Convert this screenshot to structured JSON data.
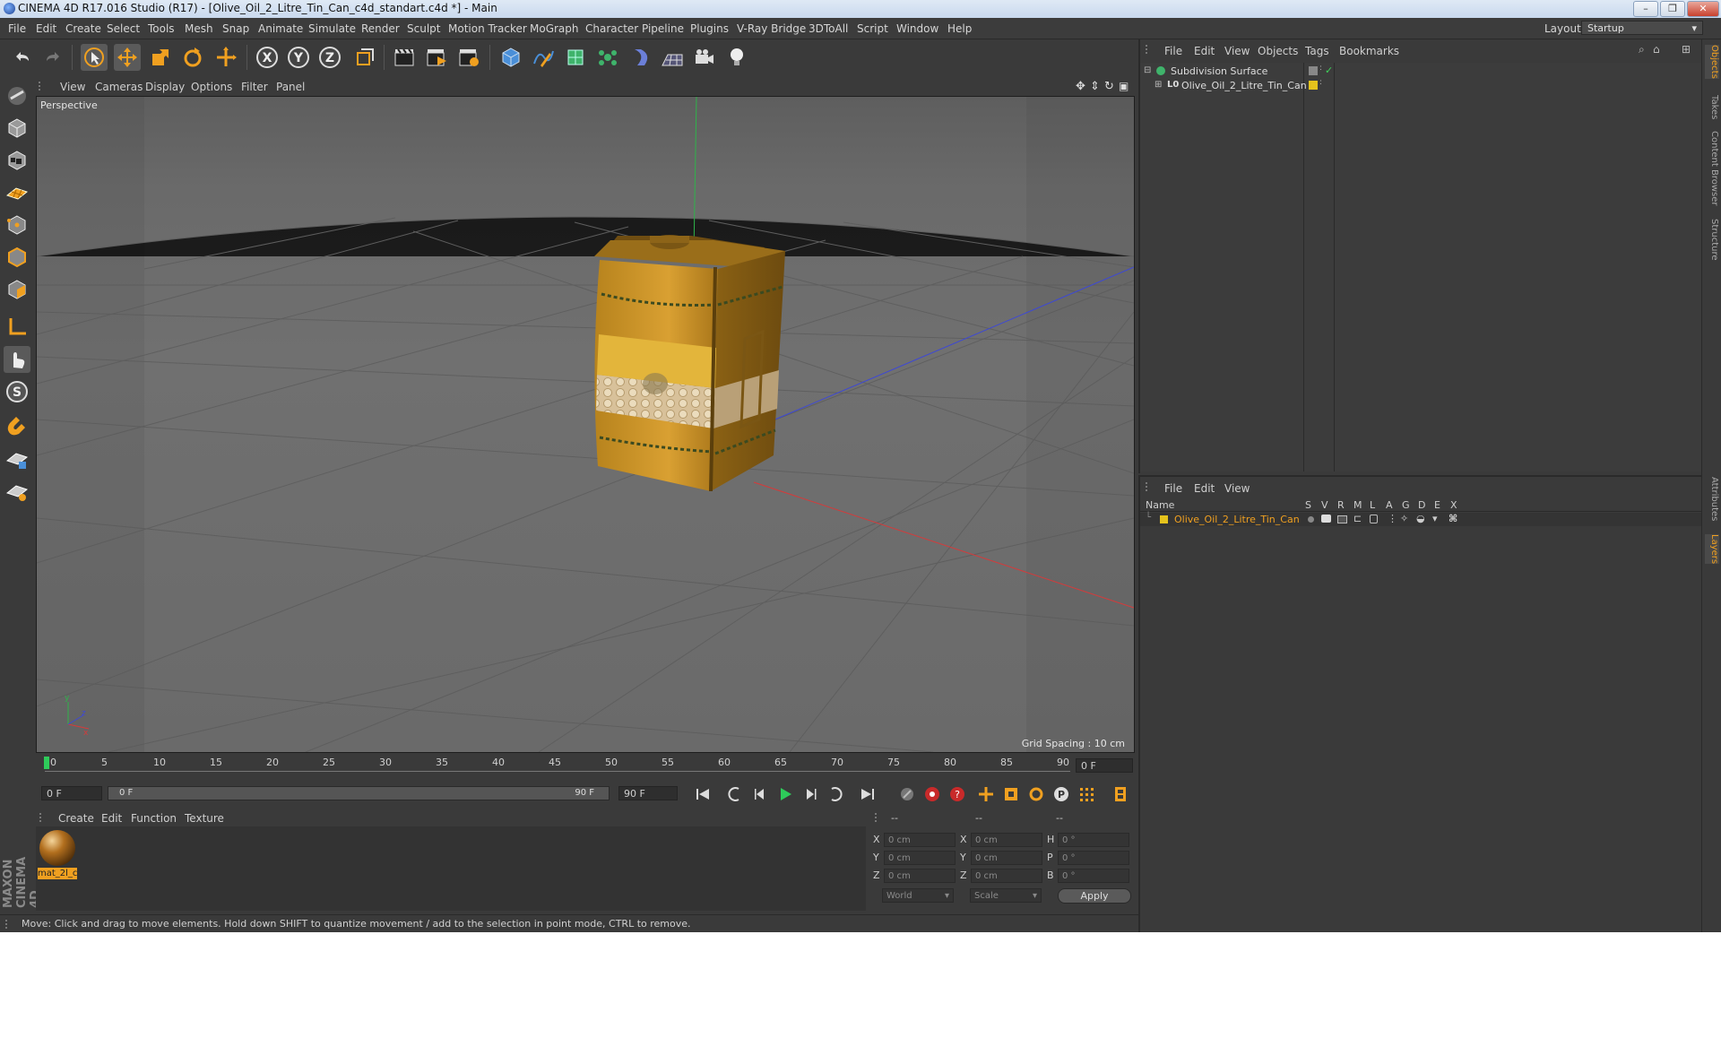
{
  "window": {
    "title": "CINEMA 4D R17.016 Studio (R17) - [Olive_Oil_2_Litre_Tin_Can_c4d_standart.c4d *] - Main",
    "controls": [
      "–",
      "❐",
      "✕"
    ]
  },
  "menubar": {
    "items": [
      "File",
      "Edit",
      "Create",
      "Select",
      "Tools",
      "Mesh",
      "Snap",
      "Animate",
      "Simulate",
      "Render",
      "Sculpt",
      "Motion Tracker",
      "MoGraph",
      "Character",
      "Pipeline",
      "Plugins",
      "V-Ray Bridge",
      "3DToAll",
      "Script",
      "Window",
      "Help"
    ],
    "layout_label": "Layout:",
    "layout_value": "Startup"
  },
  "viewport": {
    "menu": [
      "View",
      "Cameras",
      "Display",
      "Options",
      "Filter",
      "Panel"
    ],
    "label": "Perspective",
    "grid_spacing": "Grid Spacing : 10 cm"
  },
  "timeline": {
    "ticks": [
      "0",
      "5",
      "10",
      "15",
      "20",
      "25",
      "30",
      "35",
      "40",
      "45",
      "50",
      "55",
      "60",
      "65",
      "70",
      "75",
      "80",
      "85",
      "90"
    ],
    "current_frame": "0 F",
    "start_field": "0 F",
    "range_start": "0 F",
    "range_end": "90 F",
    "end_field": "90 F"
  },
  "material_manager": {
    "menu": [
      "Create",
      "Edit",
      "Function",
      "Texture"
    ],
    "materials": [
      {
        "name": "mat_2l_c"
      }
    ]
  },
  "coordinates": {
    "headers": [
      "--",
      "--",
      "--"
    ],
    "rows": [
      {
        "a": "X",
        "v1": "0 cm",
        "b": "X",
        "v2": "0 cm",
        "c": "H",
        "v3": "0 °"
      },
      {
        "a": "Y",
        "v1": "0 cm",
        "b": "Y",
        "v2": "0 cm",
        "c": "P",
        "v3": "0 °"
      },
      {
        "a": "Z",
        "v1": "0 cm",
        "b": "Z",
        "v2": "0 cm",
        "c": "B",
        "v3": "0 °"
      }
    ],
    "mode1": "World",
    "mode2": "Scale",
    "apply": "Apply"
  },
  "status": {
    "text": "Move: Click and drag to move elements. Hold down SHIFT to quantize movement / add to the selection in point mode, CTRL to remove."
  },
  "object_manager": {
    "menu": [
      "File",
      "Edit",
      "View",
      "Objects",
      "Tags",
      "Bookmarks"
    ],
    "objects": [
      {
        "name": "Subdivision Surface"
      },
      {
        "name": "Olive_Oil_2_Litre_Tin_Can"
      }
    ]
  },
  "layer_manager": {
    "menu": [
      "File",
      "Edit",
      "View"
    ],
    "columns": [
      "Name",
      "S",
      "V",
      "R",
      "M",
      "L",
      "A",
      "G",
      "D",
      "E",
      "X"
    ],
    "layers": [
      {
        "name": "Olive_Oil_2_Litre_Tin_Can",
        "color": "#e5c31c"
      }
    ]
  },
  "right_tabs": [
    "Objects",
    "Takes",
    "Content Browser",
    "Structure",
    "Attributes",
    "Layers"
  ],
  "brand": "MAXON CINEMA 4D",
  "colors": {
    "accent": "#f0a020",
    "layer": "#e5c31c",
    "selected_text": "#f0a020"
  }
}
